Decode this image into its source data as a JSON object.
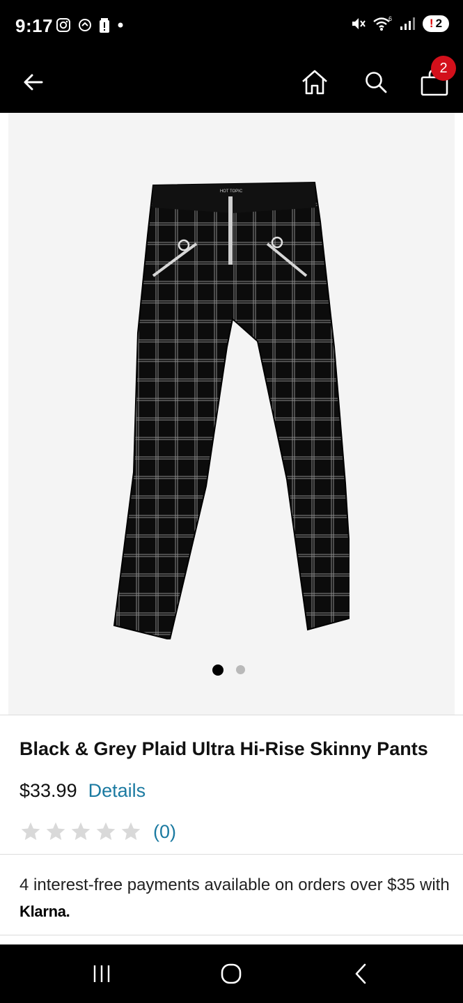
{
  "status_bar": {
    "time": "9:17",
    "notification_count": "2",
    "icons_left": [
      "instagram-icon",
      "app-icon",
      "alert-battery-icon",
      "dot-icon"
    ],
    "icons_right": [
      "mute-icon",
      "wifi-icon",
      "signal-icon"
    ]
  },
  "app_bar": {
    "back_icon": "arrow-left-icon",
    "home_icon": "home-icon",
    "search_icon": "search-icon",
    "cart_icon": "shopping-bag-icon",
    "cart_count": "2"
  },
  "gallery": {
    "image_count": 2,
    "active_index": 0,
    "brand_tag": "HOT TOPIC"
  },
  "product": {
    "name": "Black & Grey Plaid Ultra Hi-Rise Skinny Pants",
    "price": "$33.99",
    "details_label": "Details",
    "rating_stars": 0,
    "review_count": "(0)"
  },
  "payments": {
    "text": "4 interest-free payments available on orders over $35 with",
    "provider": "Klarna."
  },
  "colors": {
    "accent_link": "#1b7aa1",
    "badge": "#d3101b",
    "bar_bg": "#000000"
  }
}
